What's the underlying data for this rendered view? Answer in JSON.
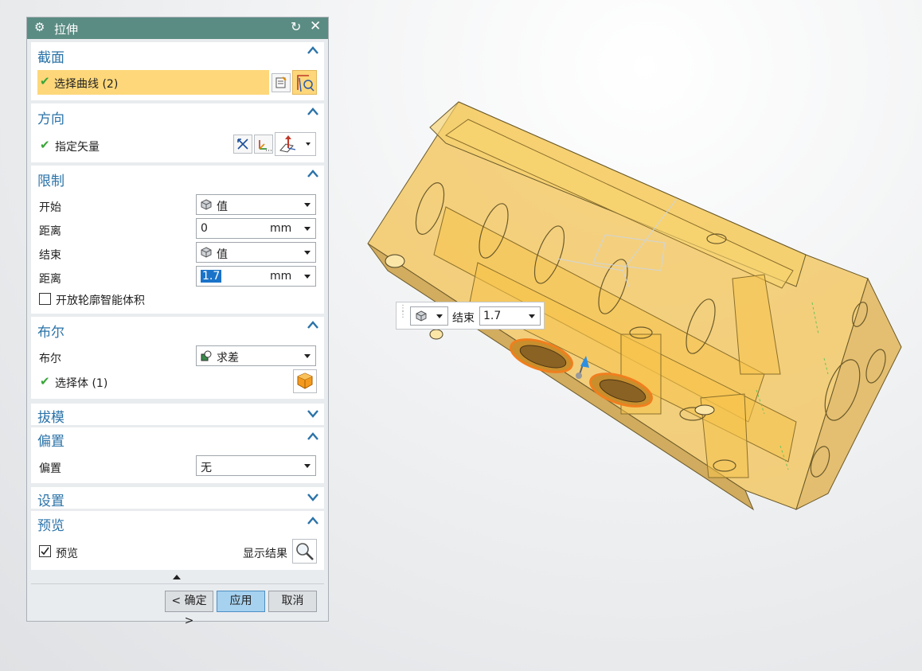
{
  "dialog": {
    "title": "拉伸",
    "title_icon": "gear-icon",
    "reset_icon": "reset-icon",
    "close_icon": "close-icon"
  },
  "section": {
    "title": "截面",
    "select_curve": "选择曲线 (2)"
  },
  "direction": {
    "title": "方向",
    "specify_vector": "指定矢量"
  },
  "limits": {
    "title": "限制",
    "start_label": "开始",
    "start_option": "值",
    "start_distance_label": "距离",
    "start_distance_value": "0",
    "start_unit": "mm",
    "end_label": "结束",
    "end_option": "值",
    "end_distance_label": "距离",
    "end_distance_value": "1.7",
    "end_unit": "mm",
    "open_profile_label": "开放轮廓智能体积"
  },
  "boolean": {
    "title": "布尔",
    "label": "布尔",
    "option": "求差",
    "select_body": "选择体 (1)"
  },
  "draft": {
    "title": "拔模"
  },
  "offset": {
    "title": "偏置",
    "label": "偏置",
    "option": "无"
  },
  "settings": {
    "title": "设置"
  },
  "preview": {
    "title": "预览",
    "checkbox_label": "预览",
    "show_result": "显示结果"
  },
  "buttons": {
    "ok": "< 确定 >",
    "apply": "应用",
    "cancel": "取消"
  },
  "floating_toolbar": {
    "label": "结束",
    "value": "1.7"
  },
  "colors": {
    "title_bar": "#5b8c84",
    "section_title": "#2b73a8",
    "highlight": "#fdd77a",
    "check": "#3aa53a",
    "part_fill": "#f2c14e",
    "selection_edge": "#f07f1e"
  }
}
